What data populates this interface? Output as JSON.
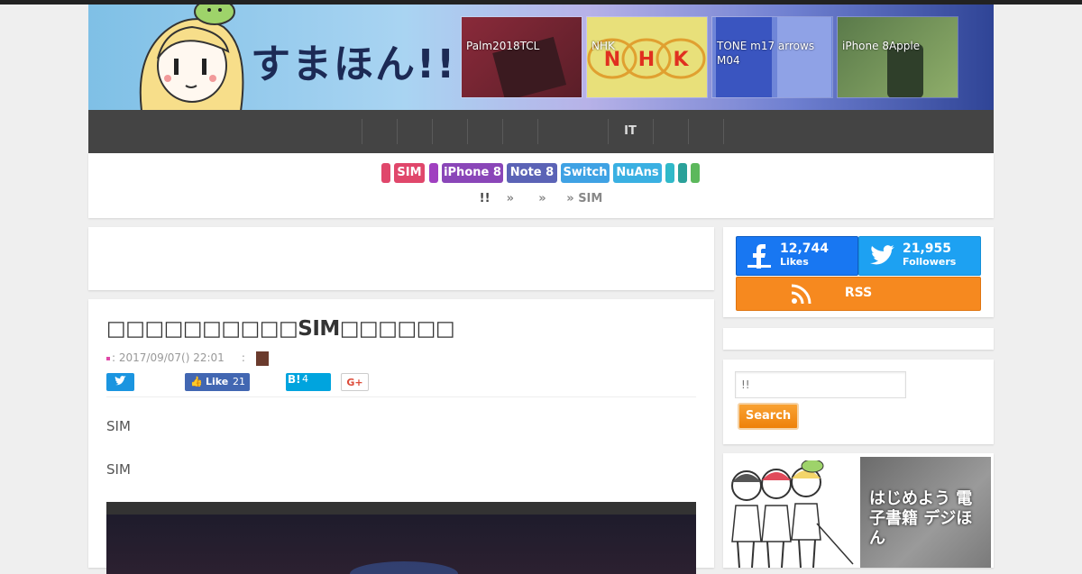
{
  "header": {
    "site_title": "すまほん!!",
    "featured": [
      {
        "caption": "Palm2018TCL"
      },
      {
        "caption": "NHK"
      },
      {
        "caption": "TONE m17 arrows M04"
      },
      {
        "caption": "iPhone 8Apple"
      }
    ]
  },
  "nav": {
    "items": [
      "",
      "",
      "",
      "",
      "",
      "",
      "IT",
      "",
      ""
    ]
  },
  "tags": [
    {
      "label": "",
      "color": "#e0476b"
    },
    {
      "label": "SIM",
      "color": "#e0476b"
    },
    {
      "label": "",
      "color": "#a040c0"
    },
    {
      "label": "iPhone 8",
      "color": "#8a46b8"
    },
    {
      "label": "Note 8",
      "color": "#5b63b6"
    },
    {
      "label": "Switch",
      "color": "#3fa2e4"
    },
    {
      "label": "NuAns",
      "color": "#3ab0e2"
    },
    {
      "label": "",
      "color": "#30b9c9"
    },
    {
      "label": "",
      "color": "#2aa19a"
    },
    {
      "label": "",
      "color": "#5cb85c"
    }
  ],
  "breadcrumb": {
    "home": "!!",
    "sep": "»",
    "current": "SIM"
  },
  "post": {
    "title": "□□□□□□□□□□SIM□□□□□□",
    "date": ": 2017/09/07() 22:01",
    "author_sep": ":",
    "share": {
      "like_label": "Like",
      "like_count": "21",
      "hatena_label": "B!",
      "hatena_count": "4",
      "gplus_label": "G+"
    },
    "paragraphs": [
      "SIM",
      "SIM"
    ]
  },
  "sidebar": {
    "facebook": {
      "count": "12,744",
      "label": "Likes",
      "color": "#1877f2"
    },
    "twitter": {
      "count": "21,955",
      "label": "Followers",
      "color": "#1da1f2"
    },
    "rss": {
      "label": "RSS",
      "color": "#f6891f"
    },
    "search": {
      "placeholder": "!!",
      "button": "Search"
    },
    "banner_text": "はじめよう 電子書籍 デジほん"
  }
}
